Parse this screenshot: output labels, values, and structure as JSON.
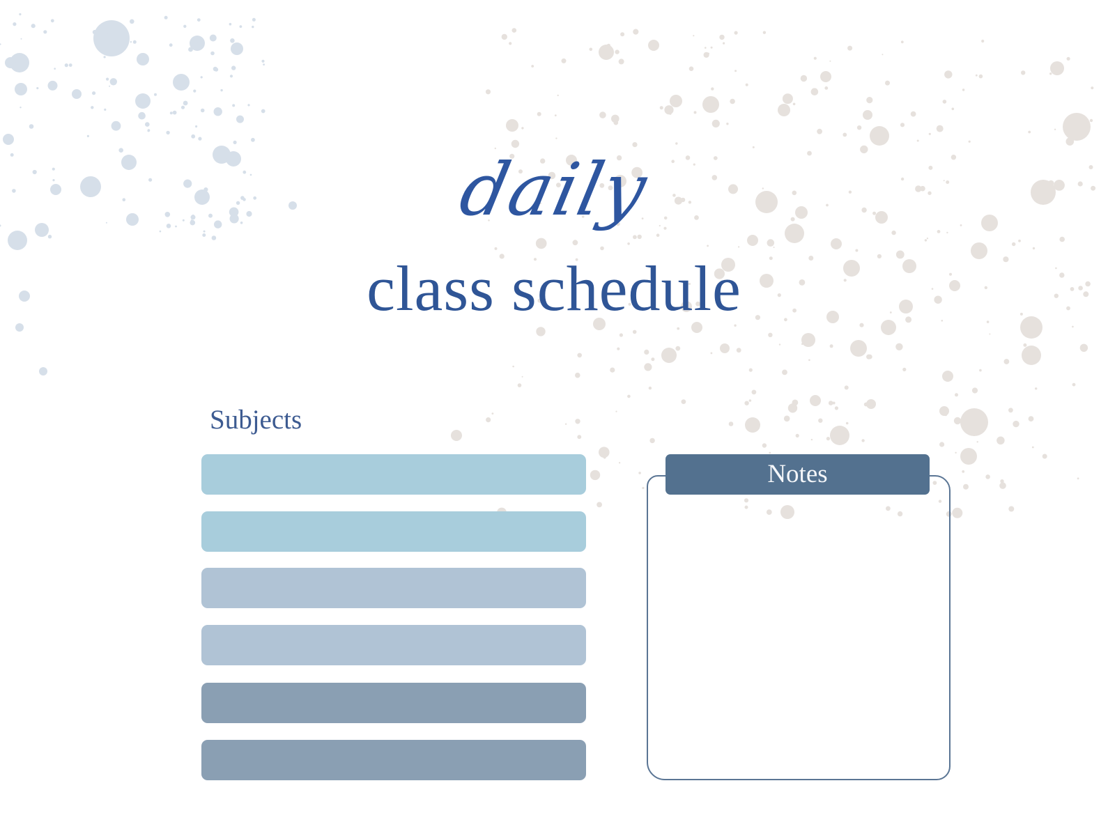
{
  "header": {
    "script_title": "daily",
    "main_title": "class schedule"
  },
  "subjects": {
    "label": "Subjects",
    "rows": [
      {
        "value": "",
        "color": "#a8cddc"
      },
      {
        "value": "",
        "color": "#a8cddc"
      },
      {
        "value": "",
        "color": "#b0c3d5"
      },
      {
        "value": "",
        "color": "#b0c3d5"
      },
      {
        "value": "",
        "color": "#8a9fb3"
      },
      {
        "value": "",
        "color": "#8a9fb3"
      }
    ]
  },
  "notes": {
    "label": "Notes",
    "value": "",
    "header_color": "#53718f",
    "frame_color": "#5a7594"
  },
  "theme": {
    "title_color": "#2f5596",
    "splatter_left_color": "#d6dfe9",
    "splatter_right_color": "#e6e1dd"
  }
}
